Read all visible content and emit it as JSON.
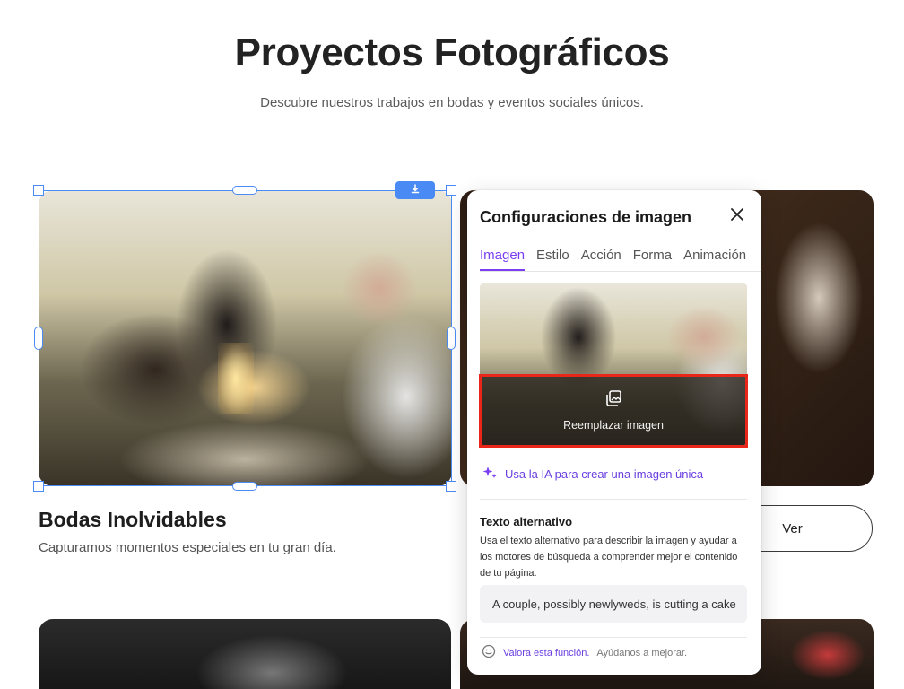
{
  "page": {
    "title": "Proyectos Fotográficos",
    "subtitle": "Descubre nuestros trabajos en bodas y eventos sociales únicos."
  },
  "cards": [
    {
      "title": "Bodas Inolvidables",
      "description": "Capturamos momentos especiales en tu gran día."
    }
  ],
  "buttons": {
    "ver": "Ver"
  },
  "panel": {
    "title": "Configuraciones de imagen",
    "tabs": [
      "Imagen",
      "Estilo",
      "Acción",
      "Forma",
      "Animación"
    ],
    "active_tab": "Imagen",
    "replace_label": "Reemplazar imagen",
    "ai_link": "Usa la IA para crear una imagen única",
    "alt_title": "Texto alternativo",
    "alt_description": "Usa el texto alternativo para describir la imagen y ayudar a los motores de búsqueda a comprender mejor el contenido de tu página.",
    "alt_value": "A couple, possibly newlyweds, is cutting a cake",
    "feedback_rate": "Valora esta función.",
    "feedback_help": "Ayúdanos a mejorar."
  },
  "colors": {
    "accent": "#7a3ff2",
    "selection": "#4a8af4",
    "highlight": "#e8271a"
  },
  "icons": [
    "download-icon",
    "close-icon",
    "image-stack-icon",
    "sparkle-icon",
    "smile-icon"
  ]
}
